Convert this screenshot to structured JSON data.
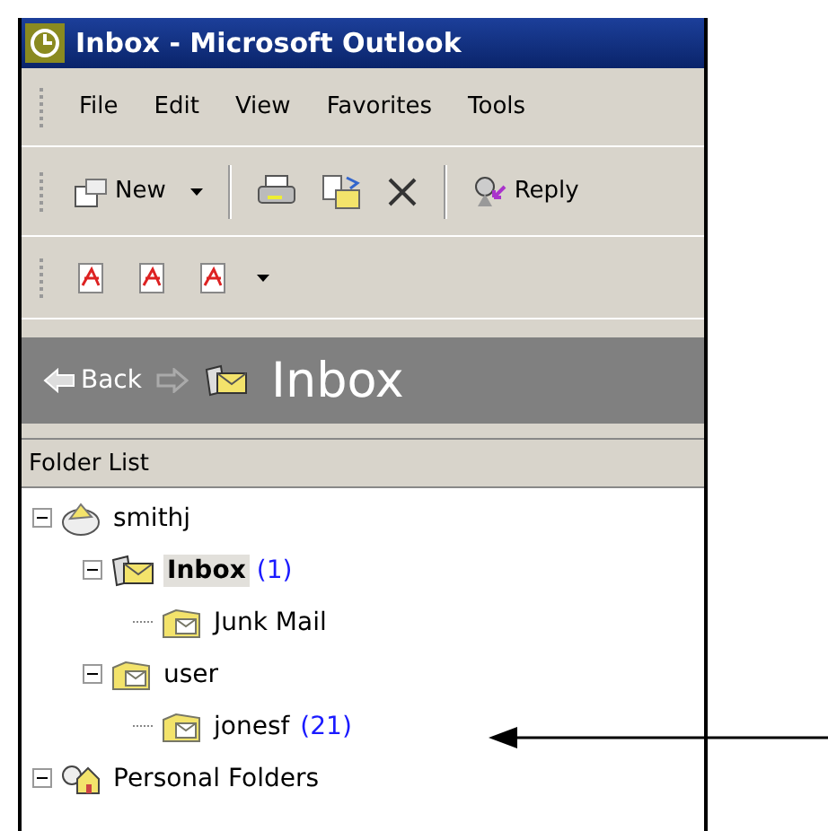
{
  "window": {
    "title": "Inbox - Microsoft Outlook"
  },
  "menu": [
    "File",
    "Edit",
    "View",
    "Favorites",
    "Tools"
  ],
  "toolbar": {
    "new_label": "New",
    "reply_label": "Reply"
  },
  "navigation": {
    "back_label": "Back",
    "forward_disabled": true,
    "folder_title": "Inbox"
  },
  "folder_list": {
    "header": "Folder List",
    "tree": [
      {
        "label": "smithj",
        "kind": "mailbox",
        "expanded": true,
        "selected": false,
        "children": [
          {
            "label": "Inbox",
            "count": "(1)",
            "kind": "inbox",
            "expanded": true,
            "selected": true,
            "children": [
              {
                "label": "Junk Mail",
                "kind": "folder",
                "selected": false
              }
            ]
          },
          {
            "label": "user",
            "kind": "folder",
            "expanded": true,
            "selected": false,
            "children": [
              {
                "label": "jonesf",
                "count": "(21)",
                "kind": "folder",
                "selected": false
              }
            ]
          }
        ]
      },
      {
        "label": "Personal Folders",
        "kind": "personal",
        "expanded": true,
        "selected": false
      }
    ]
  }
}
